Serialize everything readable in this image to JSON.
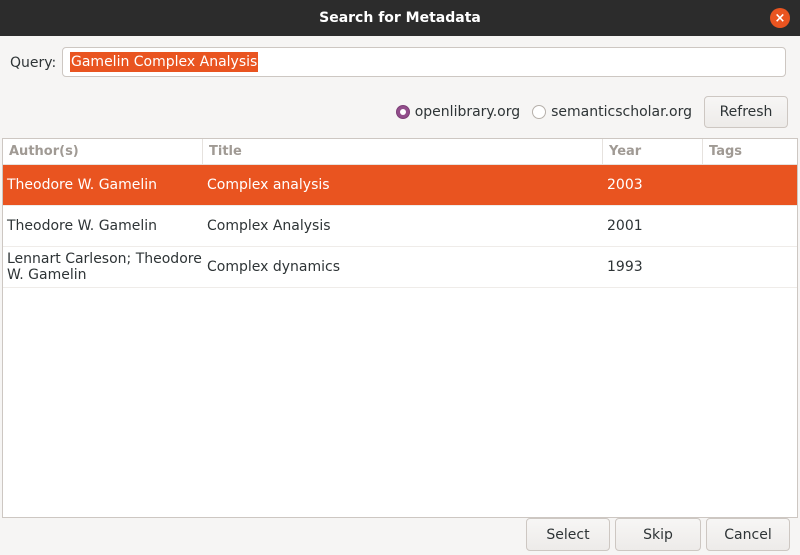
{
  "window": {
    "title": "Search for Metadata",
    "close_symbol": "×"
  },
  "query": {
    "label": "Query:",
    "value": "Gamelin  Complex Analysis"
  },
  "sources": {
    "options": [
      {
        "label": "openlibrary.org",
        "selected": true
      },
      {
        "label": "semanticscholar.org",
        "selected": false
      }
    ],
    "refresh_label": "Refresh"
  },
  "table": {
    "columns": [
      "Author(s)",
      "Title",
      "Year",
      "Tags"
    ],
    "rows": [
      {
        "author": "Theodore W. Gamelin",
        "title": "Complex analysis",
        "year": "2003",
        "tags": "",
        "selected": true
      },
      {
        "author": "Theodore W. Gamelin",
        "title": "Complex Analysis",
        "year": "2001",
        "tags": "",
        "selected": false
      },
      {
        "author": "Lennart Carleson; Theodore W. Gamelin",
        "title": "Complex dynamics",
        "year": "1993",
        "tags": "",
        "selected": false
      }
    ]
  },
  "buttons": {
    "select_label": "Select",
    "skip_label": "Skip",
    "cancel_label": "Cancel"
  },
  "colors": {
    "accent": "#e95420",
    "titlebar": "#2c2c2c",
    "radio_checked": "#924d8b"
  }
}
